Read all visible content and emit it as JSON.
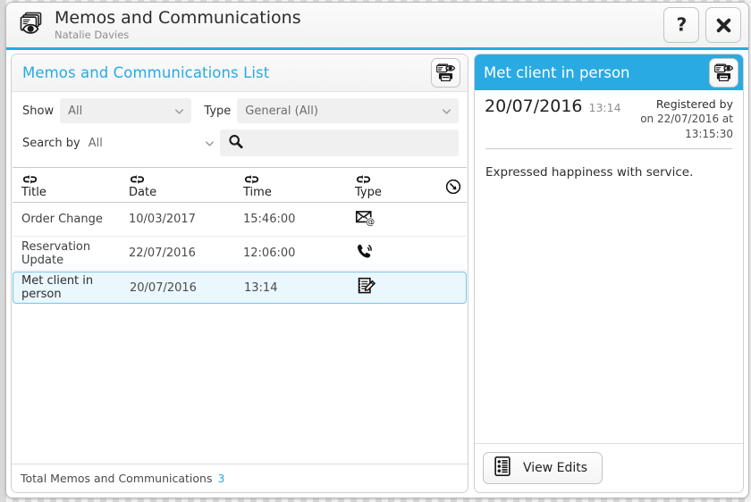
{
  "window": {
    "title": "Memos and Communications",
    "subtitle": "Natalie Davies",
    "app_icon": "documents-eye-icon",
    "help_label": "?",
    "close_label": "✕",
    "accent_color": "#29aae2"
  },
  "list_panel": {
    "header_title": "Memos and Communications List",
    "print_label": "print-preview",
    "filters": {
      "show_label": "Show",
      "show_value": "All",
      "type_label": "Type",
      "type_value": "General (All)",
      "search_by_label": "Search by",
      "search_by_value": "All",
      "search_value": "",
      "search_placeholder": ""
    },
    "columns": [
      {
        "label": "Title"
      },
      {
        "label": "Date"
      },
      {
        "label": "Time"
      },
      {
        "label": "Type"
      }
    ],
    "clear_filter_icon": "clear-filter-icon",
    "rows": [
      {
        "title": "Order Change",
        "date": "10/03/2017",
        "time": "15:46:00",
        "type_icon": "email-icon",
        "selected": false
      },
      {
        "title": "Reservation Update",
        "date": "22/07/2016",
        "time": "12:06:00",
        "type_icon": "phone-icon",
        "selected": false
      },
      {
        "title": "Met client in person",
        "date": "20/07/2016",
        "time": "13:14",
        "type_icon": "note-edit-icon",
        "selected": true
      }
    ],
    "footer_label": "Total Memos and Communications",
    "footer_count": "3"
  },
  "detail_panel": {
    "header_title": "Met client in person",
    "print_label": "print-preview",
    "date": "20/07/2016",
    "time": "13:14",
    "registered_by_label": "Registered by",
    "registered_on": "on 22/07/2016 at 13:15:30",
    "body_text": "Expressed happiness with service.",
    "view_edits_label": "View Edits"
  }
}
